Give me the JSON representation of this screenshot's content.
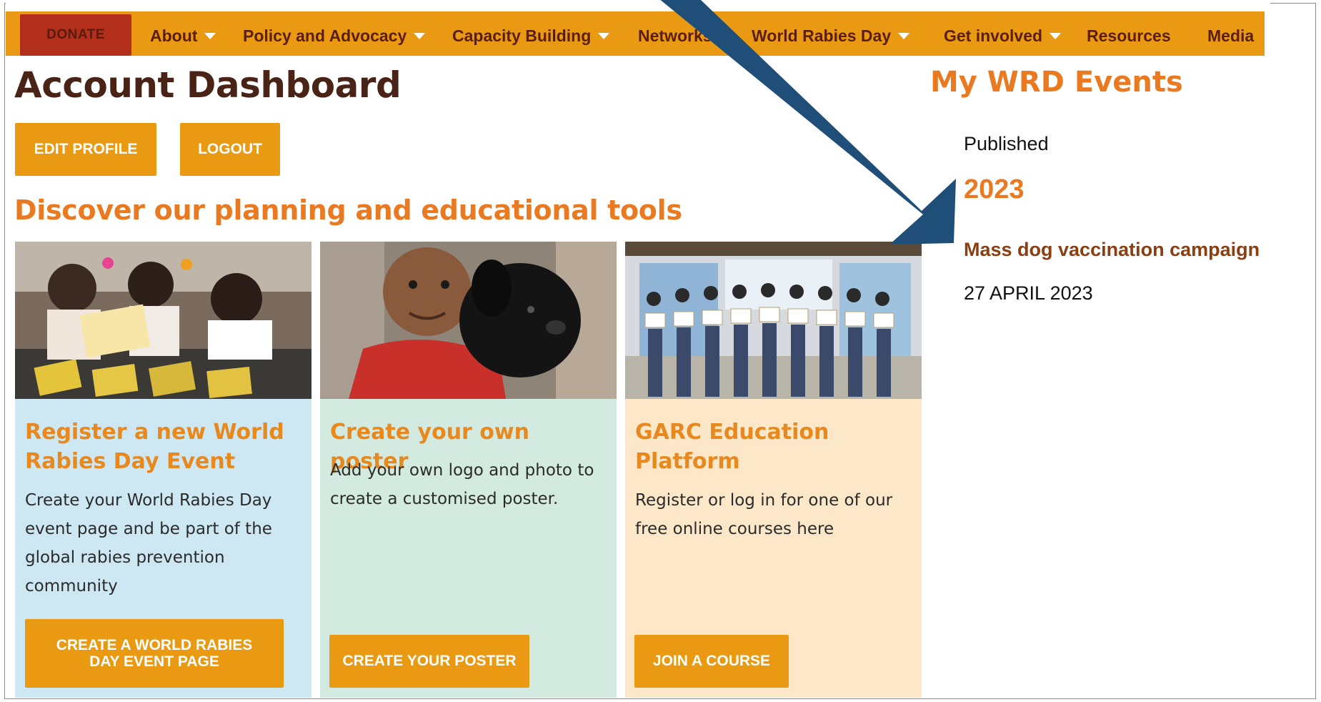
{
  "nav": {
    "donate": "DONATE",
    "items": [
      {
        "label": "About",
        "dropdown": true
      },
      {
        "label": "Policy and Advocacy",
        "dropdown": true
      },
      {
        "label": "Capacity Building",
        "dropdown": true
      },
      {
        "label": "Networks",
        "dropdown": true
      },
      {
        "label": "World Rabies Day",
        "dropdown": true
      },
      {
        "label": "Get involved",
        "dropdown": true
      },
      {
        "label": "Resources",
        "dropdown": false
      },
      {
        "label": "Media",
        "dropdown": false
      }
    ]
  },
  "main": {
    "title": "Account Dashboard",
    "edit_profile": "EDIT PROFILE",
    "logout": "LOGOUT",
    "tools_heading": "Discover our planning and educational tools",
    "cards": [
      {
        "title": "Register a new World Rabies Day Event",
        "text": "Create your World Rabies Day event page and be part of the global rabies prevention community",
        "button": "CREATE A WORLD RABIES DAY EVENT PAGE",
        "bg": "#cde8f3"
      },
      {
        "title": "Create your own poster",
        "text": "Add your own logo and photo to create a customised poster.",
        "button": "CREATE YOUR POSTER",
        "bg": "#d2eadf"
      },
      {
        "title": "GARC Education Platform",
        "text": "Register or log in for one of our free online courses here",
        "button": "JOIN A COURSE",
        "bg": "#fce8c8"
      }
    ]
  },
  "sidebar": {
    "title": "My WRD Events",
    "status": "Published",
    "year": "2023",
    "event_name": "Mass dog vaccination campaign",
    "event_date": "27 APRIL 2023"
  },
  "colors": {
    "nav_bg": "#ea9a12",
    "donate_bg": "#b22f1b",
    "accent": "#e97a22",
    "heading_dark": "#4a2317",
    "arrow": "#1f4e79"
  }
}
